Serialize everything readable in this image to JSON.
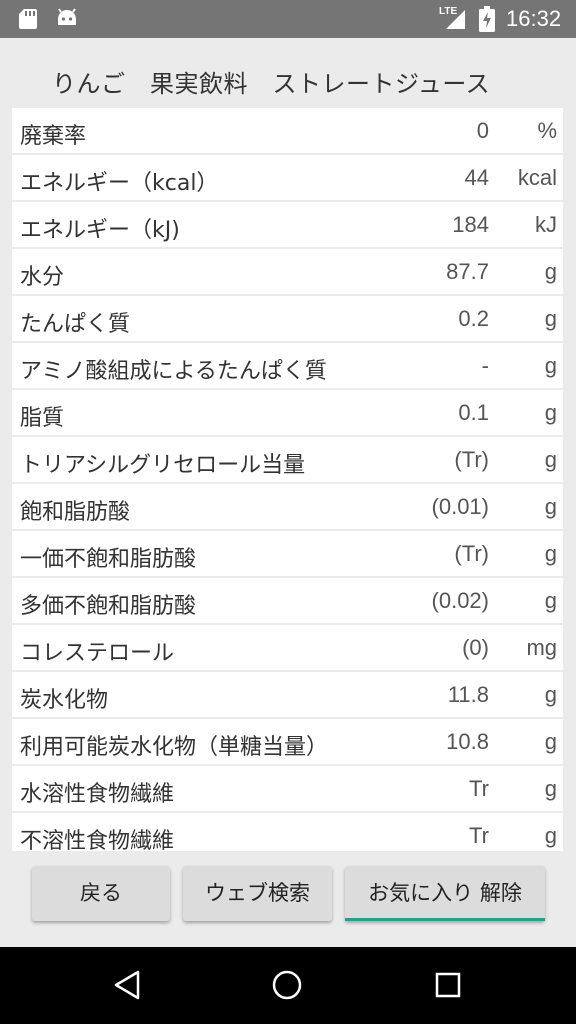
{
  "status_bar": {
    "network": "LTE",
    "time": "16:32"
  },
  "title": "りんご　果実飲料　ストレートジュース",
  "rows": [
    {
      "name": "廃棄率",
      "value": "0",
      "unit": "%"
    },
    {
      "name": "エネルギー（kcal）",
      "value": "44",
      "unit": "kcal"
    },
    {
      "name": "エネルギー（kJ)",
      "value": "184",
      "unit": "kJ"
    },
    {
      "name": "水分",
      "value": "87.7",
      "unit": "g"
    },
    {
      "name": "たんぱく質",
      "value": "0.2",
      "unit": "g"
    },
    {
      "name": "アミノ酸組成によるたんぱく質",
      "value": "-",
      "unit": "g"
    },
    {
      "name": "脂質",
      "value": "0.1",
      "unit": "g"
    },
    {
      "name": "トリアシルグリセロール当量",
      "value": "(Tr)",
      "unit": "g"
    },
    {
      "name": "飽和脂肪酸",
      "value": "(0.01)",
      "unit": "g"
    },
    {
      "name": "一価不飽和脂肪酸",
      "value": "(Tr)",
      "unit": "g"
    },
    {
      "name": "多価不飽和脂肪酸",
      "value": "(0.02)",
      "unit": "g"
    },
    {
      "name": "コレステロール",
      "value": "(0)",
      "unit": "mg"
    },
    {
      "name": "炭水化物",
      "value": "11.8",
      "unit": "g"
    },
    {
      "name": "利用可能炭水化物（単糖当量）",
      "value": "10.8",
      "unit": "g"
    },
    {
      "name": "水溶性食物繊維",
      "value": "Tr",
      "unit": "g"
    },
    {
      "name": "不溶性食物繊維",
      "value": "Tr",
      "unit": "g"
    }
  ],
  "buttons": {
    "back": "戻る",
    "web_search": "ウェブ検索",
    "favorite_remove": "お気に入り 解除"
  },
  "colors": {
    "accent": "#2a9d8f",
    "status_bar": "#757575",
    "nav_bar": "#000000"
  },
  "icons": {
    "status": [
      "sd-card-icon",
      "android-icon",
      "signal-icon",
      "battery-charging-icon"
    ],
    "nav": [
      "back-triangle-icon",
      "home-circle-icon",
      "recents-square-icon"
    ]
  }
}
